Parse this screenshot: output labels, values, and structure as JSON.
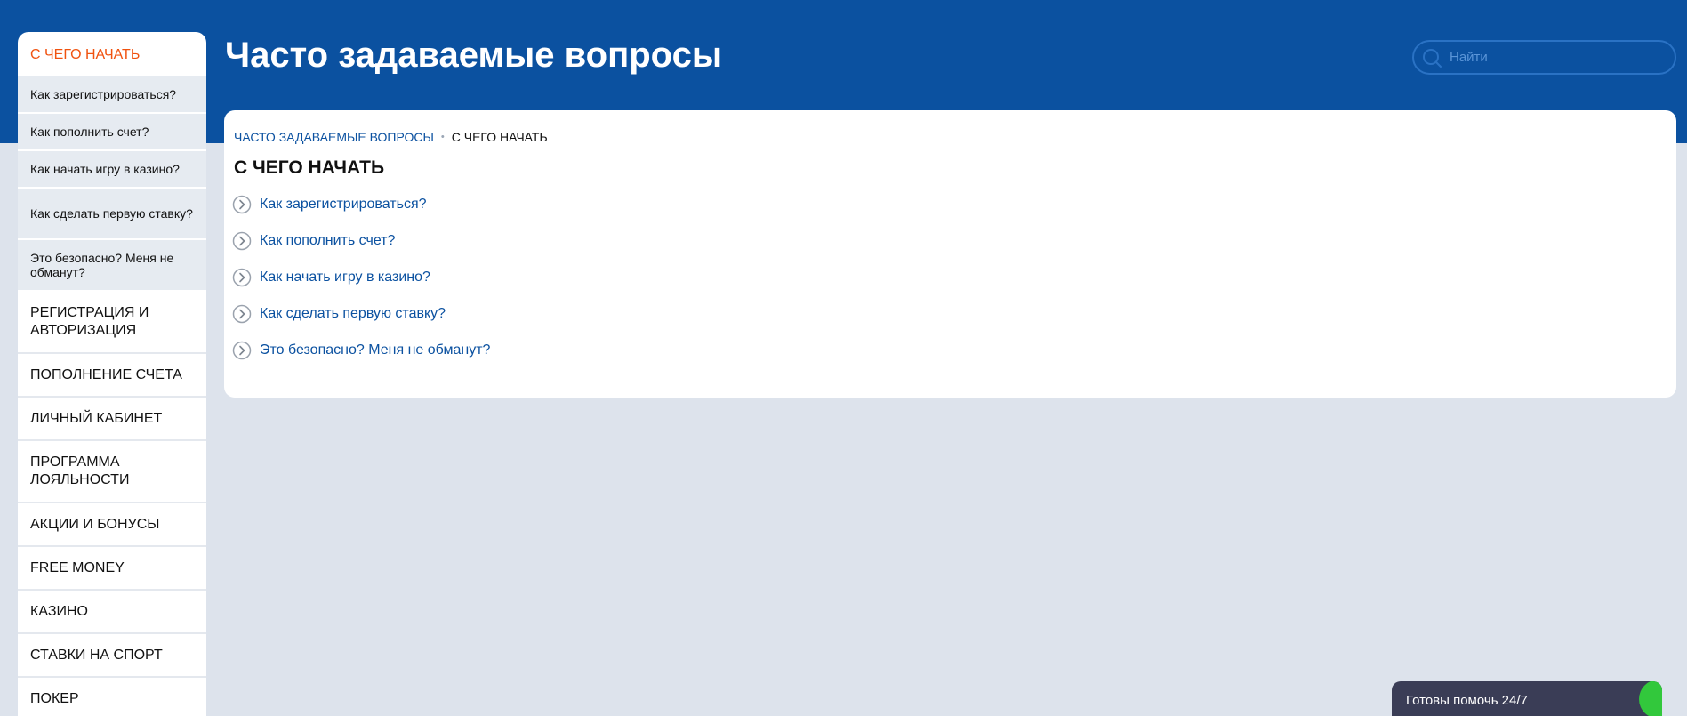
{
  "header": {
    "title": "Часто задаваемые вопросы",
    "search_placeholder": "Найти"
  },
  "sidebar": {
    "active_section": "С ЧЕГО НАЧАТЬ",
    "sub_items": [
      "Как зарегистрироваться?",
      "Как пополнить счет?",
      "Как начать игру в казино?",
      "Как сделать первую ставку?",
      "Это безопасно? Меня не обманут?"
    ],
    "sections": [
      "РЕГИСТРАЦИЯ И АВТОРИЗАЦИЯ",
      "ПОПОЛНЕНИЕ СЧЕТА",
      "ЛИЧНЫЙ КАБИНЕТ",
      "ПРОГРАММА ЛОЯЛЬНОСТИ",
      "АКЦИИ И БОНУСЫ",
      "FREE MONEY",
      "КАЗИНО",
      "СТАВКИ НА СПОРТ",
      "ПОКЕР"
    ]
  },
  "breadcrumb": {
    "root": "ЧАСТО ЗАДАВАЕМЫЕ ВОПРОСЫ",
    "separator": "•",
    "current": "С ЧЕГО НАЧАТЬ"
  },
  "main": {
    "section_title": "С ЧЕГО НАЧАТЬ",
    "questions": [
      "Как зарегистрироваться?",
      "Как пополнить счет?",
      "Как начать игру в казино?",
      "Как сделать первую ставку?",
      "Это безопасно? Меня не обманут?"
    ]
  },
  "help_widget": {
    "label": "Готовы помочь 24/7"
  },
  "colors": {
    "brand_blue": "#0b51a0",
    "accent_orange": "#f0520f",
    "page_bg": "#dde3ec",
    "online_green": "#32c83c"
  },
  "icons": {
    "search": "search-icon",
    "question_arrow": "chevron-right-circle-icon"
  }
}
